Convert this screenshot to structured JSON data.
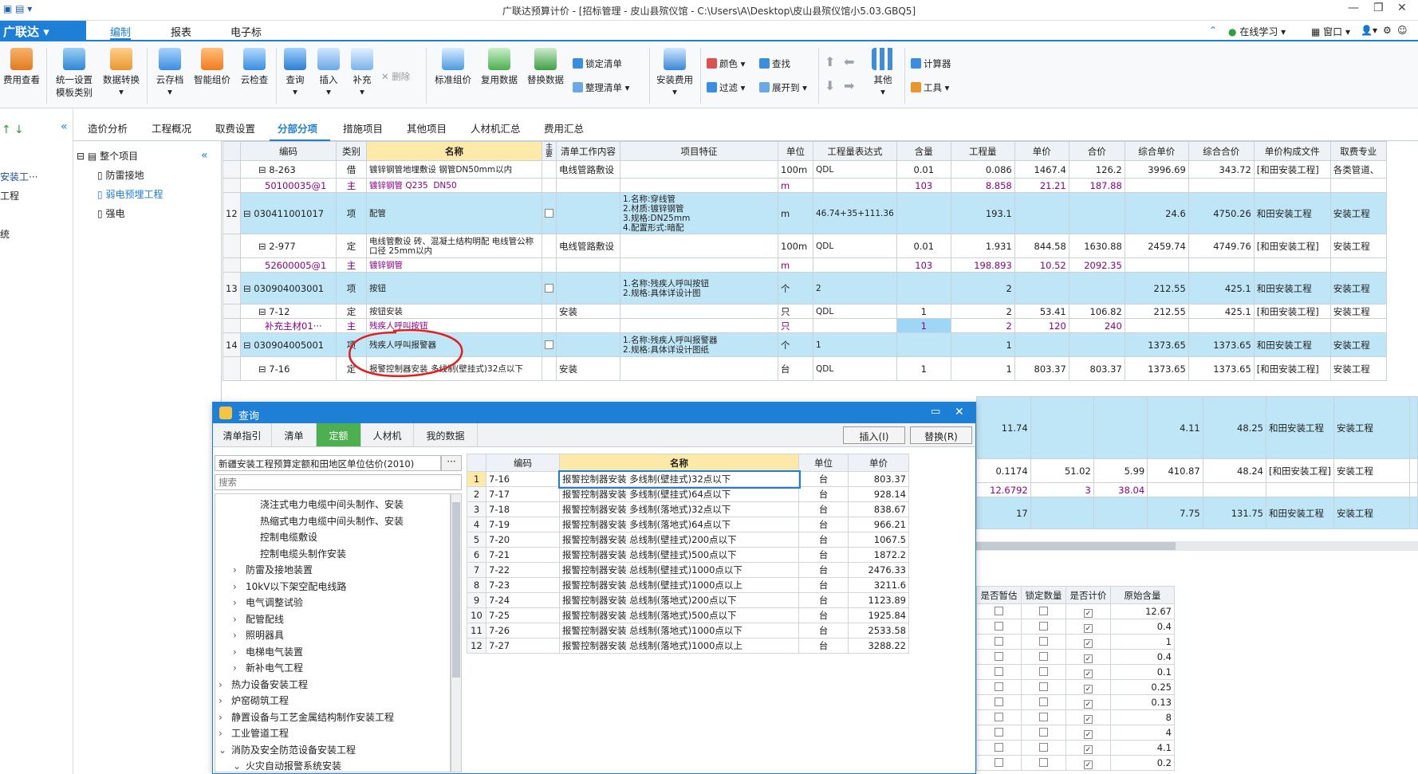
{
  "window": {
    "title": "广联达预算计价 - [招标管理 - 皮山县殡仪馆 - C:\\Users\\A\\Desktop\\皮山县殡仪馆小5.03.GBQ5]"
  },
  "menu": {
    "logo": "广联达",
    "tabs": [
      "编制",
      "报表",
      "电子标"
    ],
    "right": [
      "在线学习",
      "窗口"
    ]
  },
  "ribbon": {
    "big_buttons": [
      "费用查看",
      "统一设置",
      "数据转换",
      "云存档",
      "智能组价",
      "云检查",
      "查询",
      "插入",
      "补充",
      "标准组价",
      "复用数据",
      "替换数据",
      "安装费用",
      "其他"
    ],
    "sub_label": "模板类别",
    "delete": "删除",
    "lock_list": "锁定清单",
    "organize_list": "整理清单",
    "color": "颜色",
    "find": "查找",
    "filter": "过滤",
    "expand_to": "展开到",
    "calculator": "计算器",
    "tools": "工具"
  },
  "left_nav": {
    "items": [
      "安装工···",
      "工程",
      "统"
    ]
  },
  "tabs": [
    "造价分析",
    "工程概况",
    "取费设置",
    "分部分项",
    "措施项目",
    "其他项目",
    "人材机汇总",
    "费用汇总"
  ],
  "tree": {
    "root": "整个项目",
    "children": [
      "防雷接地",
      "弱电预埋工程",
      "强电"
    ]
  },
  "grid": {
    "headers": [
      "编码",
      "类别",
      "名称",
      "主要",
      "清单工作内容",
      "项目特征",
      "单位",
      "工程量表达式",
      "含量",
      "工程量",
      "单价",
      "合价",
      "综合单价",
      "综合合价",
      "单价构成文件",
      "取费专业"
    ],
    "rows": [
      {
        "idx": "",
        "code": "8-263",
        "type": "借",
        "name": "镀锌钢管地埋敷设 钢管DN50mm以内",
        "work": "电线管路敷设",
        "feat": "",
        "unit": "100m",
        "expr": "QDL",
        "qty_ratio": "0.01",
        "qty": "0.086",
        "price": "1467.4",
        "total": "126.2",
        "cprice": "3996.69",
        "ctotal": "343.72",
        "file": "[和田安装工程]",
        "prof": "各类管道、"
      },
      {
        "idx": "",
        "code": "50100035@1",
        "type": "主",
        "name": "镀锌钢管 Q235  DN50",
        "work": "",
        "feat": "",
        "unit": "m",
        "expr": "",
        "qty_ratio": "103",
        "qty": "8.858",
        "price": "21.21",
        "total": "187.88",
        "cprice": "",
        "ctotal": "",
        "file": "",
        "prof": ""
      },
      {
        "idx": "12",
        "code": "030411001017",
        "type": "项",
        "name": "配管",
        "work": "",
        "feat": "1.名称:穿线管\n2.材质:镀锌钢管\n3.规格:DN25mm\n4.配置形式:暗配",
        "unit": "m",
        "expr": "46.74+35+111.36",
        "qty_ratio": "",
        "qty": "193.1",
        "price": "",
        "total": "",
        "cprice": "24.6",
        "ctotal": "4750.26",
        "file": "和田安装工程",
        "prof": "安装工程"
      },
      {
        "idx": "",
        "code": "2-977",
        "type": "定",
        "name": "电线管敷设 砖、混凝土结构明配 电线管公称口径 25mm以内",
        "work": "电线管路敷设",
        "feat": "",
        "unit": "100m",
        "expr": "QDL",
        "qty_ratio": "0.01",
        "qty": "1.931",
        "price": "844.58",
        "total": "1630.88",
        "cprice": "2459.74",
        "ctotal": "4749.76",
        "file": "[和田安装工程]",
        "prof": "安装工程"
      },
      {
        "idx": "",
        "code": "52600005@1",
        "type": "主",
        "name": "镀锌钢管",
        "work": "",
        "feat": "",
        "unit": "m",
        "expr": "",
        "qty_ratio": "103",
        "qty": "198.893",
        "price": "10.52",
        "total": "2092.35",
        "cprice": "",
        "ctotal": "",
        "file": "",
        "prof": ""
      },
      {
        "idx": "13",
        "code": "030904003001",
        "type": "项",
        "name": "按钮",
        "work": "",
        "feat": "1.名称:残疾人呼叫按钮\n2.规格:具体详设计图",
        "unit": "个",
        "expr": "2",
        "qty_ratio": "",
        "qty": "2",
        "price": "",
        "total": "",
        "cprice": "212.55",
        "ctotal": "425.1",
        "file": "和田安装工程",
        "prof": "安装工程"
      },
      {
        "idx": "",
        "code": "7-12",
        "type": "定",
        "name": "按钮安装",
        "work": "安装",
        "feat": "",
        "unit": "只",
        "expr": "QDL",
        "qty_ratio": "1",
        "qty": "2",
        "price": "53.41",
        "total": "106.82",
        "cprice": "212.55",
        "ctotal": "425.1",
        "file": "[和田安装工程]",
        "prof": "安装工程"
      },
      {
        "idx": "",
        "code": "补充主材01···",
        "type": "主",
        "name": "残疾人呼叫按钮",
        "work": "",
        "feat": "",
        "unit": "只",
        "expr": "",
        "qty_ratio": "1",
        "qty": "2",
        "price": "120",
        "total": "240",
        "cprice": "",
        "ctotal": "",
        "file": "",
        "prof": ""
      },
      {
        "idx": "14",
        "code": "030904005001",
        "type": "项",
        "name": "残疾人呼叫报警器",
        "work": "",
        "feat": "1.名称:残疾人呼叫报警器\n2.规格:具体详设计图纸",
        "unit": "个",
        "expr": "1",
        "qty_ratio": "",
        "qty": "1",
        "price": "",
        "total": "",
        "cprice": "1373.65",
        "ctotal": "1373.65",
        "file": "和田安装工程",
        "prof": "安装工程"
      },
      {
        "idx": "",
        "code": "7-16",
        "type": "定",
        "name": "报警控制器安装 多线制(壁挂式)32点以下",
        "work": "安装",
        "feat": "",
        "unit": "台",
        "expr": "QDL",
        "qty_ratio": "1",
        "qty": "1",
        "price": "803.37",
        "total": "803.37",
        "cprice": "1373.65",
        "ctotal": "1373.65",
        "file": "[和田安装工程]",
        "prof": "安装工程"
      }
    ]
  },
  "partial_rows": [
    {
      "qty": "11.74",
      "price": "",
      "total": "",
      "cprice": "4.11",
      "ctotal": "48.25",
      "file": "和田安装工程",
      "prof": "安装工程"
    },
    {
      "qty": "0.1174",
      "price": "51.02",
      "total": "5.99",
      "cprice": "410.87",
      "ctotal": "48.24",
      "file": "[和田安装工程]",
      "prof": "安装工程"
    },
    {
      "qty": "12.6792",
      "price": "3",
      "total": "38.04",
      "cprice": "",
      "ctotal": "",
      "file": "",
      "prof": ""
    },
    {
      "qty": "17",
      "price": "",
      "total": "",
      "cprice": "7.75",
      "ctotal": "131.75",
      "file": "和田安装工程",
      "prof": "安装工程"
    }
  ],
  "dialog": {
    "title": "查询",
    "tabs": [
      "清单指引",
      "清单",
      "定额",
      "人材机",
      "我的数据"
    ],
    "insert_btn": "插入(I)",
    "replace_btn": "替换(R)",
    "library": "新疆安装工程预算定额和田地区单位估价(2010)",
    "search_placeholder": "搜索",
    "tree_items": [
      {
        "text": "浇注式电力电缆中间头制作、安装",
        "indent": 3,
        "arrow": ""
      },
      {
        "text": "热缩式电力电缆中间头制作、安装",
        "indent": 3,
        "arrow": ""
      },
      {
        "text": "控制电缆敷设",
        "indent": 3,
        "arrow": ""
      },
      {
        "text": "控制电缆头制作安装",
        "indent": 3,
        "arrow": ""
      },
      {
        "text": "防雷及接地装置",
        "indent": 2,
        "arrow": "›"
      },
      {
        "text": "10kV以下架空配电线路",
        "indent": 2,
        "arrow": "›"
      },
      {
        "text": "电气调整试验",
        "indent": 2,
        "arrow": "›"
      },
      {
        "text": "配管配线",
        "indent": 2,
        "arrow": "›"
      },
      {
        "text": "照明器具",
        "indent": 2,
        "arrow": "›"
      },
      {
        "text": "电梯电气装置",
        "indent": 2,
        "arrow": "›"
      },
      {
        "text": "新补电气工程",
        "indent": 2,
        "arrow": "›"
      },
      {
        "text": "热力设备安装工程",
        "indent": 1,
        "arrow": "›"
      },
      {
        "text": "炉窑砌筑工程",
        "indent": 1,
        "arrow": "›"
      },
      {
        "text": "静置设备与工艺金属结构制作安装工程",
        "indent": 1,
        "arrow": "›"
      },
      {
        "text": "工业管道工程",
        "indent": 1,
        "arrow": "›"
      },
      {
        "text": "消防及安全防范设备安装工程",
        "indent": 1,
        "arrow": "⌄"
      },
      {
        "text": "火灾自动报警系统安装",
        "indent": 2,
        "arrow": "⌄"
      }
    ],
    "table_headers": [
      "",
      "编码",
      "名称",
      "单位",
      "单价"
    ],
    "table_rows": [
      [
        "1",
        "7-16",
        "报警控制器安装 多线制(壁挂式)32点以下",
        "台",
        "803.37"
      ],
      [
        "2",
        "7-17",
        "报警控制器安装 多线制(壁挂式)64点以下",
        "台",
        "928.14"
      ],
      [
        "3",
        "7-18",
        "报警控制器安装 多线制(落地式)32点以下",
        "台",
        "838.67"
      ],
      [
        "4",
        "7-19",
        "报警控制器安装 多线制(落地式)64点以下",
        "台",
        "966.21"
      ],
      [
        "5",
        "7-20",
        "报警控制器安装 总线制(壁挂式)200点以下",
        "台",
        "1067.5"
      ],
      [
        "6",
        "7-21",
        "报警控制器安装 总线制(壁挂式)500点以下",
        "台",
        "1872.2"
      ],
      [
        "7",
        "7-22",
        "报警控制器安装 总线制(壁挂式)1000点以下",
        "台",
        "2476.33"
      ],
      [
        "8",
        "7-23",
        "报警控制器安装 总线制(壁挂式)1000点以上",
        "台",
        "3211.6"
      ],
      [
        "9",
        "7-24",
        "报警控制器安装 总线制(落地式)200点以下",
        "台",
        "1123.89"
      ],
      [
        "10",
        "7-25",
        "报警控制器安装 总线制(落地式)500点以下",
        "台",
        "1925.84"
      ],
      [
        "11",
        "7-26",
        "报警控制器安装 总线制(落地式)1000点以下",
        "台",
        "2533.58"
      ],
      [
        "12",
        "7-27",
        "报警控制器安装 总线制(落地式)1000点以上",
        "台",
        "3288.22"
      ]
    ]
  },
  "bottom_panel": {
    "headers": [
      "是否暂估",
      "锁定数量",
      "是否计价",
      "原始含量"
    ],
    "rows": [
      [
        "12.67"
      ],
      [
        "0.4"
      ],
      [
        "1"
      ],
      [
        "0.4"
      ],
      [
        "0.1"
      ],
      [
        "0.25"
      ],
      [
        "0.13"
      ],
      [
        "8"
      ],
      [
        "4"
      ],
      [
        "4.1"
      ],
      [
        "0.2"
      ]
    ]
  }
}
